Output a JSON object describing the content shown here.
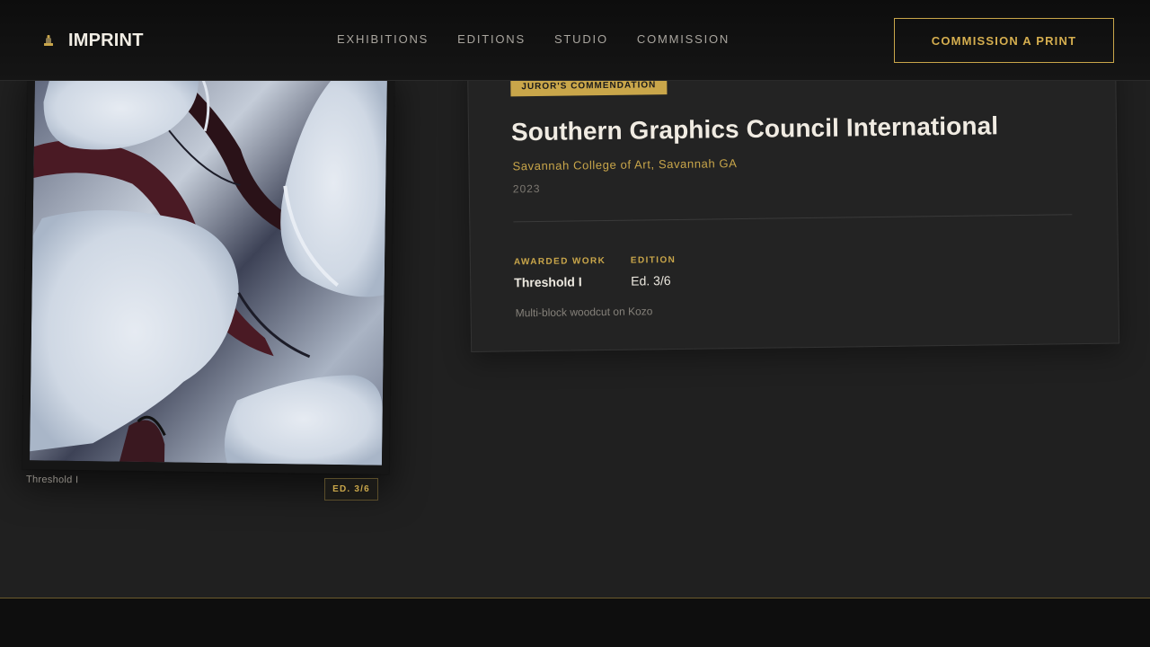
{
  "brand": {
    "name": "IMPRINT",
    "icon": "stamp-hand-icon"
  },
  "nav": {
    "items": [
      "EXHIBITIONS",
      "EDITIONS",
      "STUDIO",
      "COMMISSION"
    ]
  },
  "cta": {
    "label": "COMMISSION A PRINT"
  },
  "artwork": {
    "caption": "Threshold I",
    "edition_badge": "ED. 3/6"
  },
  "award": {
    "badge": "JUROR'S COMMENDATION",
    "title": "Southern Graphics Council International",
    "venue": "Savannah College of Art, Savannah GA",
    "year": "2023",
    "awarded_work_label": "AWARDED WORK",
    "awarded_work": "Threshold I",
    "edition_label": "EDITION",
    "edition": "Ed. 3/6",
    "medium": "Multi-block woodcut on Kozo"
  },
  "colors": {
    "accent": "#c9a64a",
    "background": "#202020",
    "header": "#0d0d0d"
  }
}
